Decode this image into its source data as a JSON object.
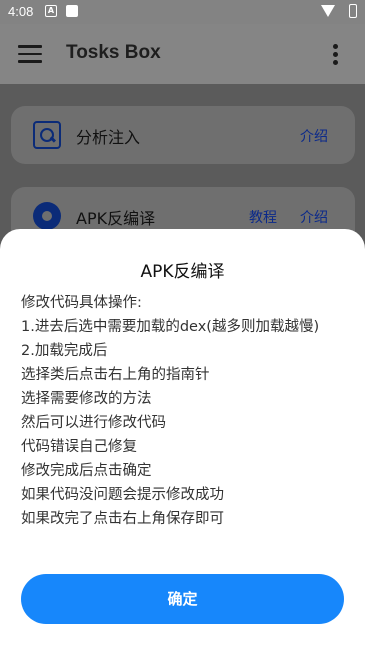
{
  "status_bar": {
    "time": "4:08",
    "icons": [
      "notification-a-icon",
      "notification-square-icon",
      "wifi-icon",
      "battery-icon"
    ],
    "notification_a_glyph": "A"
  },
  "app_bar": {
    "title": "Tosks Box",
    "menu_icon": "menu-icon",
    "overflow_icon": "more-vert-icon"
  },
  "cards": [
    {
      "icon": "scan-search-icon",
      "label": "分析注入",
      "links": [
        "介绍"
      ]
    },
    {
      "icon": "gear-icon",
      "label": "APK反编译",
      "links": [
        "教程",
        "介绍"
      ]
    }
  ],
  "sheet": {
    "title": "APK反编译",
    "lines": [
      "修改代码具体操作:",
      "1.进去后选中需要加载的dex(越多则加载越慢)",
      "2.加载完成后",
      "选择类后点击右上角的指南针",
      "选择需要修改的方法",
      "然后可以进行修改代码",
      "代码错误自己修复",
      "修改完成后点击确定",
      "如果代码没问题会提示修改成功",
      "如果改完了点击右上角保存即可"
    ],
    "confirm_label": "确定"
  },
  "colors": {
    "accent": "#1787fb",
    "link": "#0c2a8a",
    "icon": "#0b2b78"
  }
}
